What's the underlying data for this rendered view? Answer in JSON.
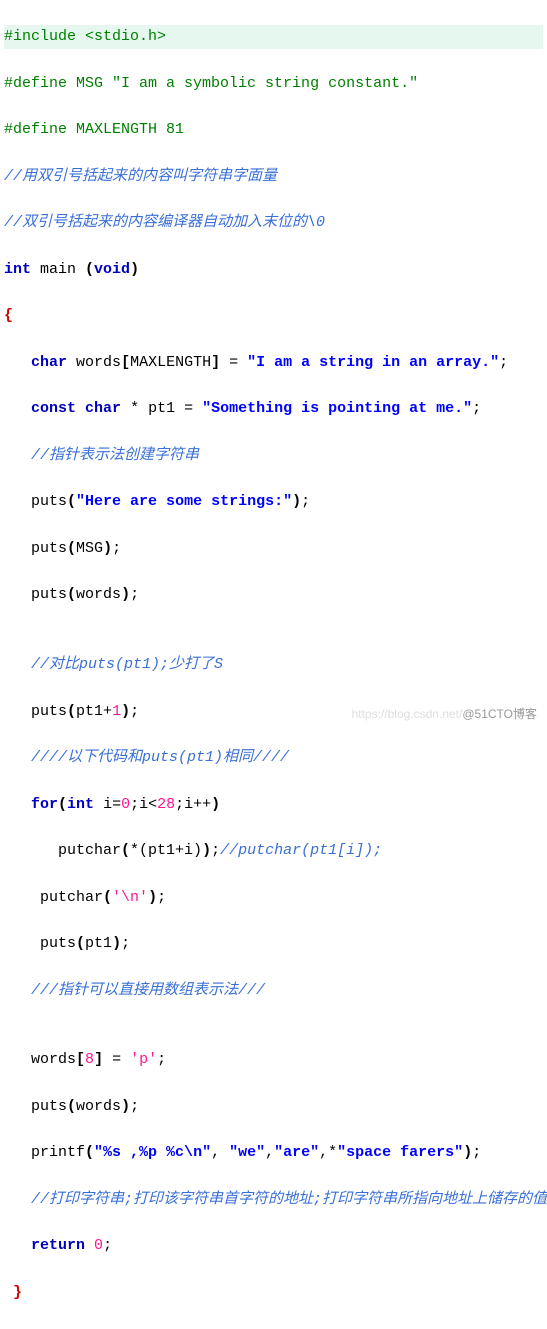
{
  "code": {
    "l1": {
      "include": "#include ",
      "hdr": "<stdio.h>"
    },
    "l2": {
      "def": "#define MSG ",
      "str": "\"I am a symbolic string constant.\""
    },
    "l3": {
      "def": "#define MAXLENGTH ",
      "num": "81"
    },
    "l4": "//用双引号括起来的内容叫字符串字面量",
    "l5": "//双引号括起来的内容编译器自动加入末位的\\0",
    "l6": {
      "kw1": "int",
      "fn": " main ",
      "p1": "(",
      "kw2": "void",
      "p2": ")"
    },
    "l7": "{",
    "l8": {
      "indent": "   ",
      "kw": "char",
      "sp": " ",
      "id": "words",
      "br1": "[",
      "mac": "MAXLENGTH",
      "br2": "]",
      "eq": " = ",
      "str": "\"I am a string in an array.\"",
      "semi": ";"
    },
    "l9": {
      "indent": "   ",
      "kwc": "const",
      "sp1": " ",
      "kwt": "char",
      "sp2": " * ",
      "id": "pt1",
      "eq": " = ",
      "str": "\"Something is pointing at me.\"",
      "semi": ";"
    },
    "l10": {
      "indent": "   ",
      "txt": "//指针表示法创建字符串"
    },
    "l11": {
      "indent": "   ",
      "fn": "puts",
      "p1": "(",
      "str": "\"Here are some strings:\"",
      "p2": ")",
      "semi": ";"
    },
    "l12": {
      "indent": "   ",
      "fn": "puts",
      "p1": "(",
      "arg": "MSG",
      "p2": ")",
      "semi": ";"
    },
    "l13": {
      "indent": "   ",
      "fn": "puts",
      "p1": "(",
      "arg": "words",
      "p2": ")",
      "semi": ";"
    },
    "l14": "",
    "l15": {
      "indent": "   ",
      "txt": "//对比puts(pt1);少打了S"
    },
    "l16": {
      "indent": "   ",
      "fn": "puts",
      "p1": "(",
      "arg": "pt1+",
      "num": "1",
      "p2": ")",
      "semi": ";"
    },
    "l17": {
      "indent": "   ",
      "txt": "////以下代码和puts(pt1)相同////"
    },
    "l18": {
      "indent": "   ",
      "kw": "for",
      "p1": "(",
      "kwt": "int",
      "body": " i=",
      "n1": "0",
      "s1": ";i<",
      "n2": "28",
      "s2": ";i++",
      "p2": ")"
    },
    "l19": {
      "indent": "      ",
      "fn": "putchar",
      "p1": "(",
      "arg": "*(pt1+i)",
      "p2": ")",
      "semi": ";",
      "cmt": "//putchar(pt1[i]);"
    },
    "l20": {
      "indent": "    ",
      "fn": "putchar",
      "p1": "(",
      "ch": "'\\n'",
      "p2": ")",
      "semi": ";"
    },
    "l21": {
      "indent": "    ",
      "fn": "puts",
      "p1": "(",
      "arg": "pt1",
      "p2": ")",
      "semi": ";"
    },
    "l22": {
      "indent": "   ",
      "txt": "///指针可以直接用数组表示法///"
    },
    "l23": "",
    "l24": {
      "indent": "   ",
      "id": "words",
      "br1": "[",
      "num": "8",
      "br2": "]",
      "eq": " = ",
      "ch": "'p'",
      "semi": ";"
    },
    "l25": {
      "indent": "   ",
      "fn": "puts",
      "p1": "(",
      "arg": "words",
      "p2": ")",
      "semi": ";"
    },
    "l26": {
      "indent": "   ",
      "fn": "printf",
      "p1": "(",
      "str": "\"%s ,%p %c\\n\"",
      "c1": ", ",
      "s1": "\"we\"",
      "c2": ",",
      "s2": "\"are\"",
      "c3": ",*",
      "s3": "\"space farers\"",
      "p2": ")",
      "semi": ";"
    },
    "l27": {
      "indent": "   ",
      "txt": "//打印字符串;打印该字符串首字符的地址;打印字符串所指向地址上储存的值"
    },
    "l28": {
      "indent": "   ",
      "kw": "return",
      "sp": " ",
      "num": "0",
      "semi": ";"
    },
    "l29": " }"
  },
  "watermark": {
    "left": "https://blog.csdn.net/",
    "right": "@51CTO博客"
  }
}
